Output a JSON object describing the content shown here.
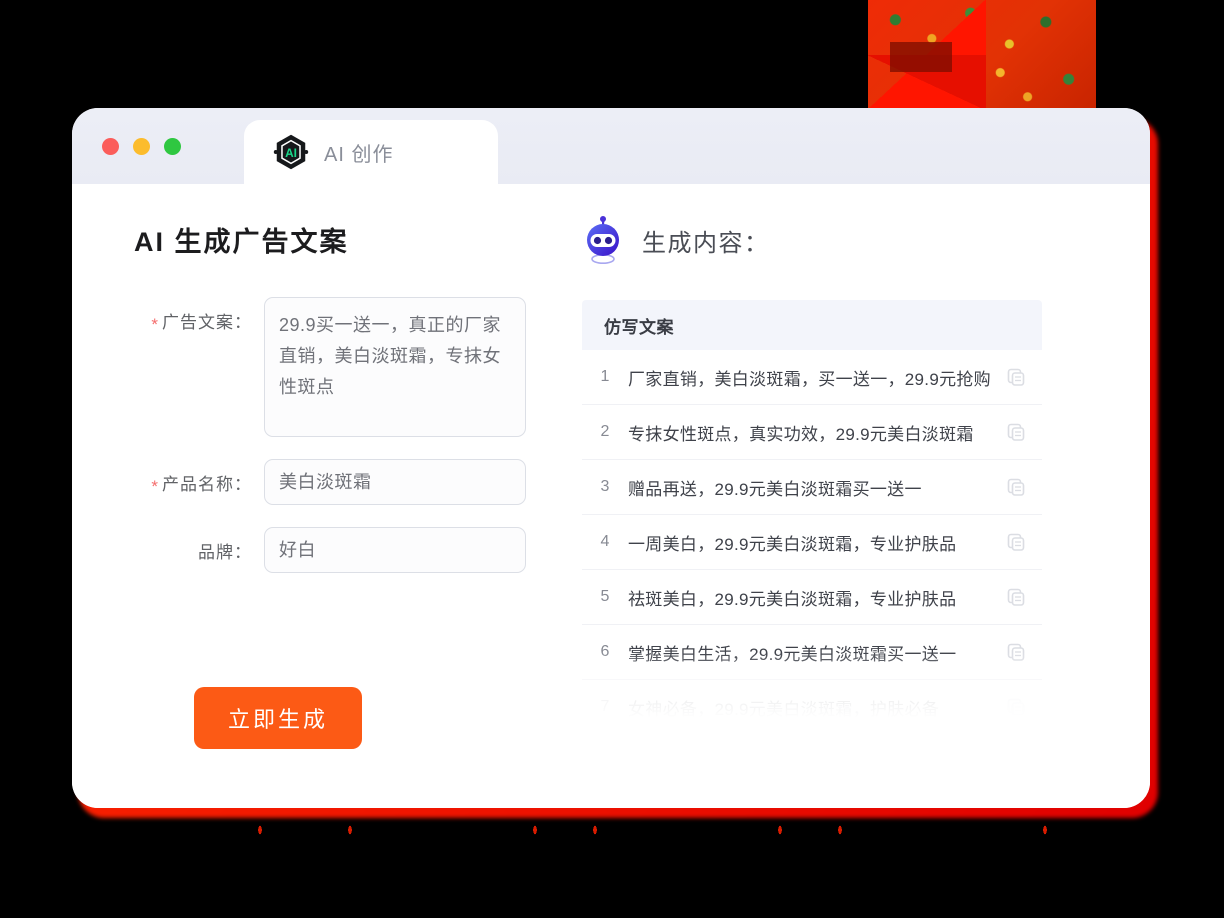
{
  "window": {
    "traffic_lights": [
      {
        "name": "close",
        "color": "#fb5d5b"
      },
      {
        "name": "minimize",
        "color": "#fcbc2d"
      },
      {
        "name": "maximize",
        "color": "#2fc741"
      }
    ],
    "tab": {
      "label": "AI 创作",
      "logo_text": "AI",
      "logo_icon": "ai-hexagon-logo"
    }
  },
  "left": {
    "page_title": "AI 生成广告文案",
    "fields": [
      {
        "label": "广告文案：",
        "required": true,
        "value": "29.9买一送一，真正的厂家直销，美白淡斑霜，专抹女性斑点",
        "type": "textarea"
      },
      {
        "label": "产品名称：",
        "required": true,
        "value": "美白淡斑霜",
        "type": "input"
      },
      {
        "label": "品牌：",
        "required": false,
        "value": "好白",
        "type": "input"
      }
    ],
    "submit_button": {
      "label": "立即生成",
      "color": "#fc5a15"
    }
  },
  "right": {
    "icon": "robot-icon",
    "title": "生成内容：",
    "table": {
      "header": "仿写文案",
      "rows": [
        {
          "index": "1",
          "text": "厂家直销，美白淡斑霜，买一送一，29.9元抢购",
          "copy_icon": "copy-icon"
        },
        {
          "index": "2",
          "text": "专抹女性斑点，真实功效，29.9元美白淡斑霜",
          "copy_icon": "copy-icon"
        },
        {
          "index": "3",
          "text": "赠品再送，29.9元美白淡斑霜买一送一",
          "copy_icon": "copy-icon"
        },
        {
          "index": "4",
          "text": "一周美白，29.9元美白淡斑霜，专业护肤品",
          "copy_icon": "copy-icon"
        },
        {
          "index": "5",
          "text": "祛斑美白，29.9元美白淡斑霜，专业护肤品",
          "copy_icon": "copy-icon"
        },
        {
          "index": "6",
          "text": "掌握美白生活，29.9元美白淡斑霜买一送一",
          "copy_icon": "copy-icon"
        },
        {
          "index": "7",
          "text": "女神必备，29.9元美白淡斑霜，护肤必备",
          "copy_icon": "copy-icon"
        }
      ]
    }
  },
  "decor": {
    "accent_red": "#ef2b06",
    "glow_red": "#ff2a00",
    "header_bg": "#f3f5fb",
    "titlebar_bg": "#eceef6"
  }
}
